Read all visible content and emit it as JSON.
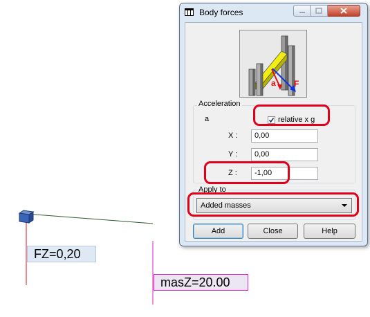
{
  "canvas": {
    "fz_label": "FZ=0,20",
    "mas_label": "masZ=20.00"
  },
  "dialog": {
    "title": "Body forces",
    "picture": {
      "label_a": "a",
      "label_f": "F"
    },
    "acceleration": {
      "group_label": "Acceleration",
      "a_label": "a",
      "relative_checked": true,
      "relative_label": "relative x g",
      "x_label": "X :",
      "x_value": "0,00",
      "y_label": "Y :",
      "y_value": "0,00",
      "z_label": "Z :",
      "z_value": "-1,00"
    },
    "apply_to": {
      "group_label": "Apply to",
      "selected": "Added masses"
    },
    "buttons": {
      "add": "Add",
      "close": "Close",
      "help": "Help"
    }
  },
  "colors": {
    "highlight_red": "#e0001a",
    "dialog_frame": "#dde8f5",
    "client_bg": "#f0f0f0",
    "mas_border": "#e020c8"
  }
}
